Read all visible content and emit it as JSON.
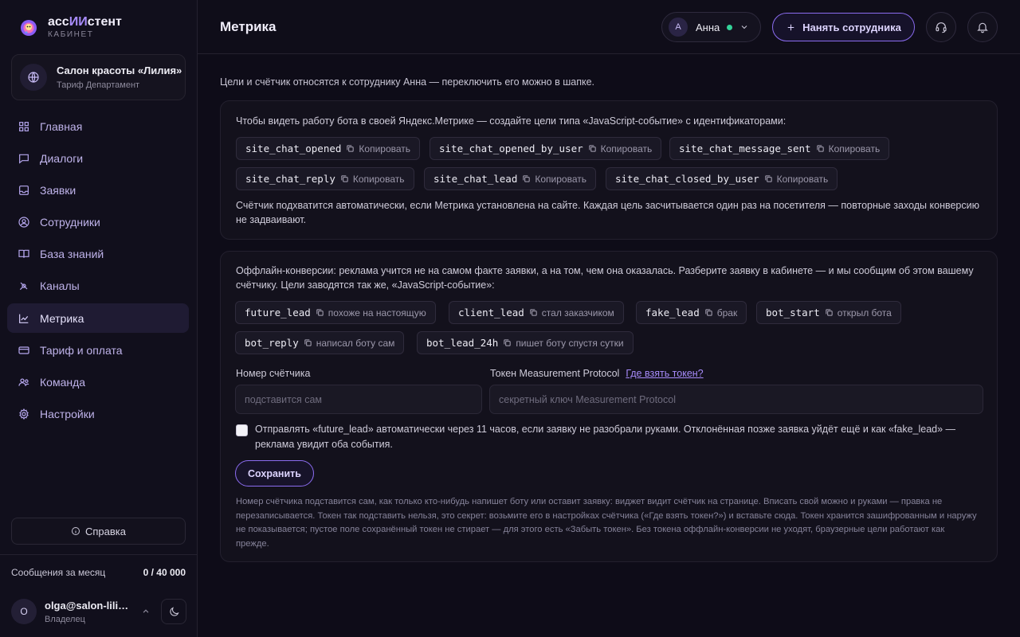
{
  "brand": {
    "name_prefix": "асс",
    "name_accent": "ИИ",
    "name_suffix": "стент",
    "subtitle": "КАБИНЕТ"
  },
  "org": {
    "name": "Салон красоты «Лилия»",
    "plan": "Тариф Департамент"
  },
  "nav": [
    {
      "label": "Главная",
      "icon": "grid-icon",
      "active": false
    },
    {
      "label": "Диалоги",
      "icon": "chat-icon",
      "active": false
    },
    {
      "label": "Заявки",
      "icon": "inbox-icon",
      "active": false
    },
    {
      "label": "Сотрудники",
      "icon": "user-circle-icon",
      "active": false
    },
    {
      "label": "База знаний",
      "icon": "book-icon",
      "active": false
    },
    {
      "label": "Каналы",
      "icon": "satellite-icon",
      "active": false
    },
    {
      "label": "Метрика",
      "icon": "chart-line-icon",
      "active": true
    },
    {
      "label": "Тариф и оплата",
      "icon": "card-icon",
      "active": false
    },
    {
      "label": "Команда",
      "icon": "users-icon",
      "active": false
    },
    {
      "label": "Настройки",
      "icon": "gear-icon",
      "active": false
    }
  ],
  "help": {
    "label": "Справка"
  },
  "usage": {
    "label": "Сообщения за месяц",
    "value": "0 / 40 000"
  },
  "user": {
    "initial": "O",
    "email": "olga@salon-liliya.ru",
    "role": "Владелец"
  },
  "header": {
    "title": "Метрика",
    "employee": {
      "initial": "А",
      "name": "Анна",
      "status_color": "#34d399"
    },
    "hire_label": "Нанять сотрудника"
  },
  "intro": "Цели и счётчик относятся к сотруднику Анна — переключить его можно в шапке.",
  "goals_card": {
    "text": "Чтобы видеть работу бота в своей Яндекс.Метрике — создайте цели типа «JavaScript-событие» с идентификаторами:",
    "copy_label": "Копировать",
    "goals": [
      "site_chat_opened",
      "site_chat_opened_by_user",
      "site_chat_message_sent",
      "site_chat_reply",
      "site_chat_lead",
      "site_chat_closed_by_user"
    ],
    "footer": "Счётчик подхватится автоматически, если Метрика установлена на сайте. Каждая цель засчитывается один раз на посетителя — повторные заходы конверсию не задваивают."
  },
  "offline_card": {
    "text": "Оффлайн-конверсии: реклама учится не на самом факте заявки, а на том, чем она оказалась. Разберите заявку в кабинете — и мы сообщим об этом вашему счётчику. Цели заводятся так же, «JavaScript-событие»:",
    "goals": [
      {
        "code": "future_lead",
        "desc": "похоже на настоящую"
      },
      {
        "code": "client_lead",
        "desc": "стал заказчиком"
      },
      {
        "code": "fake_lead",
        "desc": "брак"
      },
      {
        "code": "bot_start",
        "desc": "открыл бота"
      },
      {
        "code": "bot_reply",
        "desc": "написал боту сам"
      },
      {
        "code": "bot_lead_24h",
        "desc": "пишет боту спустя сутки"
      }
    ],
    "counter_label": "Номер счётчика",
    "counter_placeholder": "подставится сам",
    "token_label": "Токен Measurement Protocol",
    "token_link": "Где взять токен?",
    "token_placeholder": "секретный ключ Measurement Protocol",
    "auto_send_text": "Отправлять «future_lead» автоматически через 11 часов, если заявку не разобрали руками. Отклонённая позже заявка уйдёт ещё и как «fake_lead» — реклама увидит оба события.",
    "save_label": "Сохранить",
    "note": "Номер счётчика подставится сам, как только кто-нибудь напишет боту или оставит заявку: виджет видит счётчик на странице. Вписать свой можно и руками — правка не перезаписывается. Токен так подставить нельзя, это секрет: возьмите его в настройках счётчика («Где взять токен?») и вставьте сюда. Токен хранится зашифрованным и наружу не показывается; пустое поле сохранённый токен не стирает — для этого есть «Забыть токен». Без токена оффлайн-конверсии не уходят, браузерные цели работают как прежде."
  }
}
